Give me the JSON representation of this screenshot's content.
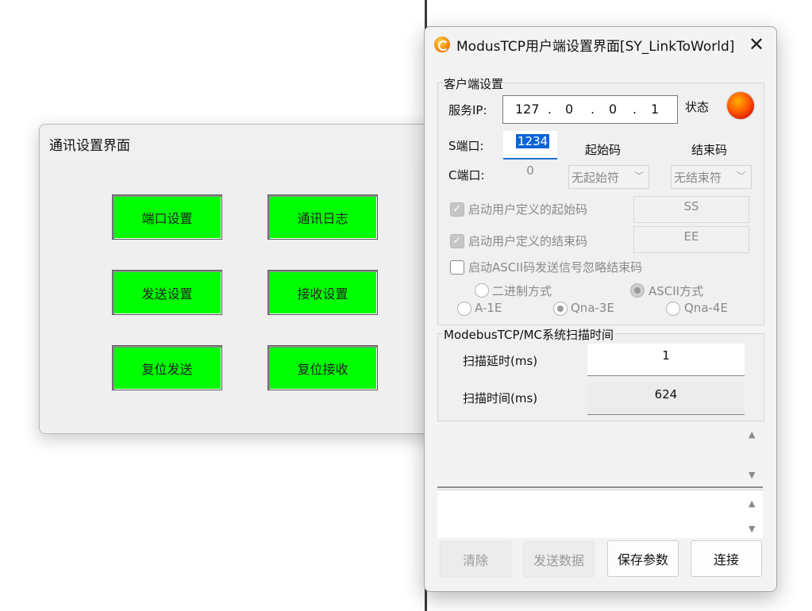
{
  "left_window": {
    "title": "通讯设置界面",
    "buttons": [
      "端口设置",
      "通讯日志",
      "发送设置",
      "接收设置",
      "复位发送",
      "复位接收"
    ]
  },
  "right_window": {
    "title": "ModusTCP用户端设置界面[SY_LinkToWorld]",
    "close": "✕",
    "client_group": {
      "label": "客户端设置",
      "server_ip_label": "服务IP:",
      "ip": [
        "127",
        ".",
        "0",
        ".",
        "0",
        ".",
        "1"
      ],
      "status_label": "状态",
      "status_color": "#ff5a00",
      "s_port_label": "S端口:",
      "s_port_value": "1234",
      "c_port_label": "C端口:",
      "c_port_value": "0",
      "start_code_label": "起始码",
      "end_code_label": "结束码",
      "start_code_combo": "无起始符",
      "end_code_combo": "无结束符",
      "custom_start_label": "启动用户定义的起始码",
      "custom_start_value": "SS",
      "custom_end_label": "启动用户定义的结束码",
      "custom_end_value": "EE",
      "ascii_ignore_label": "启动ASCII码发送信号忽略结束码",
      "radio_binary": "二进制方式",
      "radio_ascii": "ASCII方式",
      "radio_a1e": "A-1E",
      "radio_qna3e": "Qna-3E",
      "radio_qna4e": "Qna-4E"
    },
    "scan_group": {
      "label": "ModebusTCP/MC系统扫描时间",
      "delay_label": "扫描延时(ms)",
      "delay_value": "1",
      "time_label": "扫描时间(ms)",
      "time_value": "624"
    },
    "buttons": {
      "clear": "清除",
      "send": "发送数据",
      "save": "保存参数",
      "connect": "连接"
    }
  }
}
